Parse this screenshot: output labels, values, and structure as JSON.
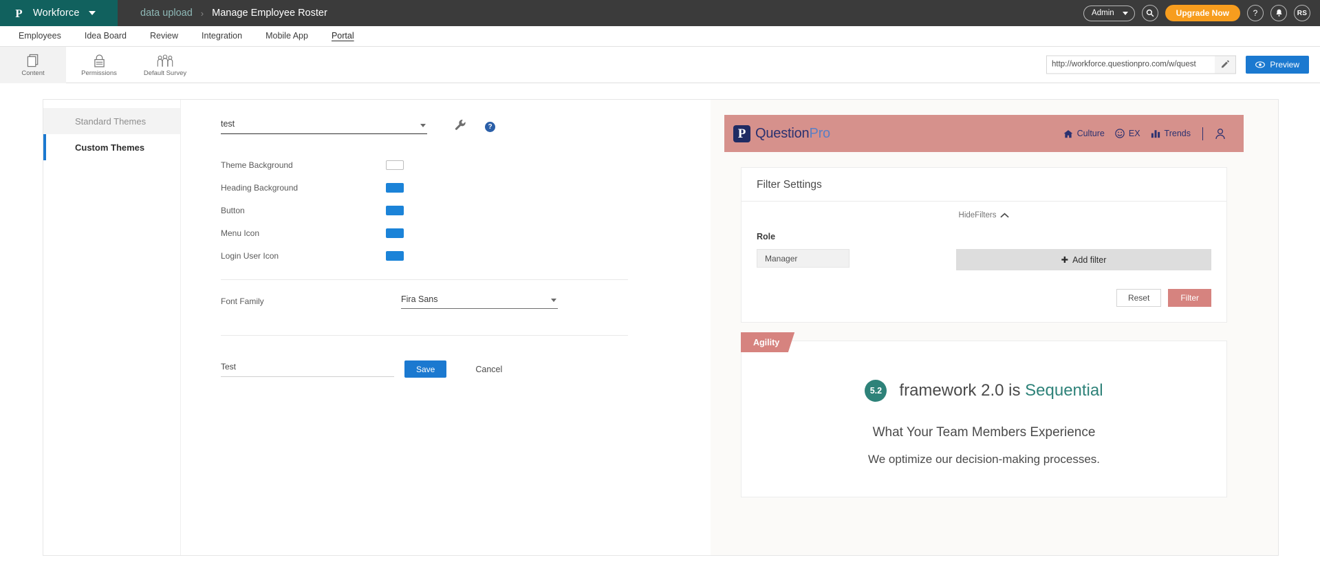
{
  "topbar": {
    "brand": "Workforce",
    "logo_glyph": "P",
    "breadcrumb": {
      "parent": "data upload",
      "separator": "›",
      "current": "Manage Employee Roster"
    },
    "admin_label": "Admin",
    "search_glyph": "●",
    "upgrade_label": "Upgrade Now",
    "help_glyph": "?",
    "bell_glyph": "●",
    "avatar_initials": "RS"
  },
  "menubar": {
    "items": [
      {
        "label": "Employees",
        "active": false
      },
      {
        "label": "Idea Board",
        "active": false
      },
      {
        "label": "Review",
        "active": false
      },
      {
        "label": "Integration",
        "active": false
      },
      {
        "label": "Mobile App",
        "active": false
      },
      {
        "label": "Portal",
        "active": true
      }
    ]
  },
  "toolbar": {
    "buttons": [
      {
        "label": "Content",
        "icon": "pages-icon"
      },
      {
        "label": "Permissions",
        "icon": "lock-icon"
      },
      {
        "label": "Default Survey",
        "icon": "people-icon"
      }
    ],
    "url_value": "http://workforce.questionpro.com/w/quest",
    "edit_icon": "pencil-icon",
    "preview_label": "Preview",
    "preview_icon": "eye-icon"
  },
  "sidebar": {
    "items": [
      {
        "label": "Standard Themes",
        "active": false
      },
      {
        "label": "Custom Themes",
        "active": true
      }
    ]
  },
  "form": {
    "theme_select_value": "test",
    "wrench_icon": "wrench-icon",
    "help_icon": "help-icon",
    "colors": [
      {
        "label": "Theme Background",
        "value": "#ffffff"
      },
      {
        "label": "Heading Background",
        "value": "#1b83d8"
      },
      {
        "label": "Button",
        "value": "#1b83d8"
      },
      {
        "label": "Menu Icon",
        "value": "#1b83d8"
      },
      {
        "label": "Login User Icon",
        "value": "#1b83d8"
      }
    ],
    "font_family_label": "Font Family",
    "font_family_value": "Fira Sans",
    "theme_name_value": "Test",
    "save_label": "Save",
    "cancel_label": "Cancel"
  },
  "preview": {
    "header": {
      "logo_badge_glyph": "P",
      "logo_text_main": "Question",
      "logo_text_accent": "Pro",
      "nav": [
        {
          "label": "Culture",
          "icon": "home-icon"
        },
        {
          "label": "EX",
          "icon": "smiley-icon"
        },
        {
          "label": "Trends",
          "icon": "bar-chart-icon"
        }
      ],
      "user_icon": "user-icon"
    },
    "filter_card": {
      "title": "Filter Settings",
      "hide_filters_label": "HideFilters",
      "chevron_icon": "chevron-up-icon",
      "role_label": "Role",
      "role_value": "Manager",
      "add_filter_label": "Add filter",
      "add_filter_icon": "plus-icon",
      "reset_label": "Reset",
      "filter_label": "Filter"
    },
    "agility_card": {
      "tag_label": "Agility",
      "score": "5.2",
      "framework_text": "framework 2.0 is",
      "framework_highlight": "Sequential",
      "experience_title": "What Your Team Members Experience",
      "experience_subtitle": "We optimize our decision-making processes."
    }
  },
  "colors": {
    "teal_brand": "#11615e",
    "topbar_bg": "#3b3b3b",
    "accent_blue": "#1b79d0",
    "orange": "#f79d1e",
    "salmon": "#d6918c",
    "teal_score": "#2e8279"
  }
}
